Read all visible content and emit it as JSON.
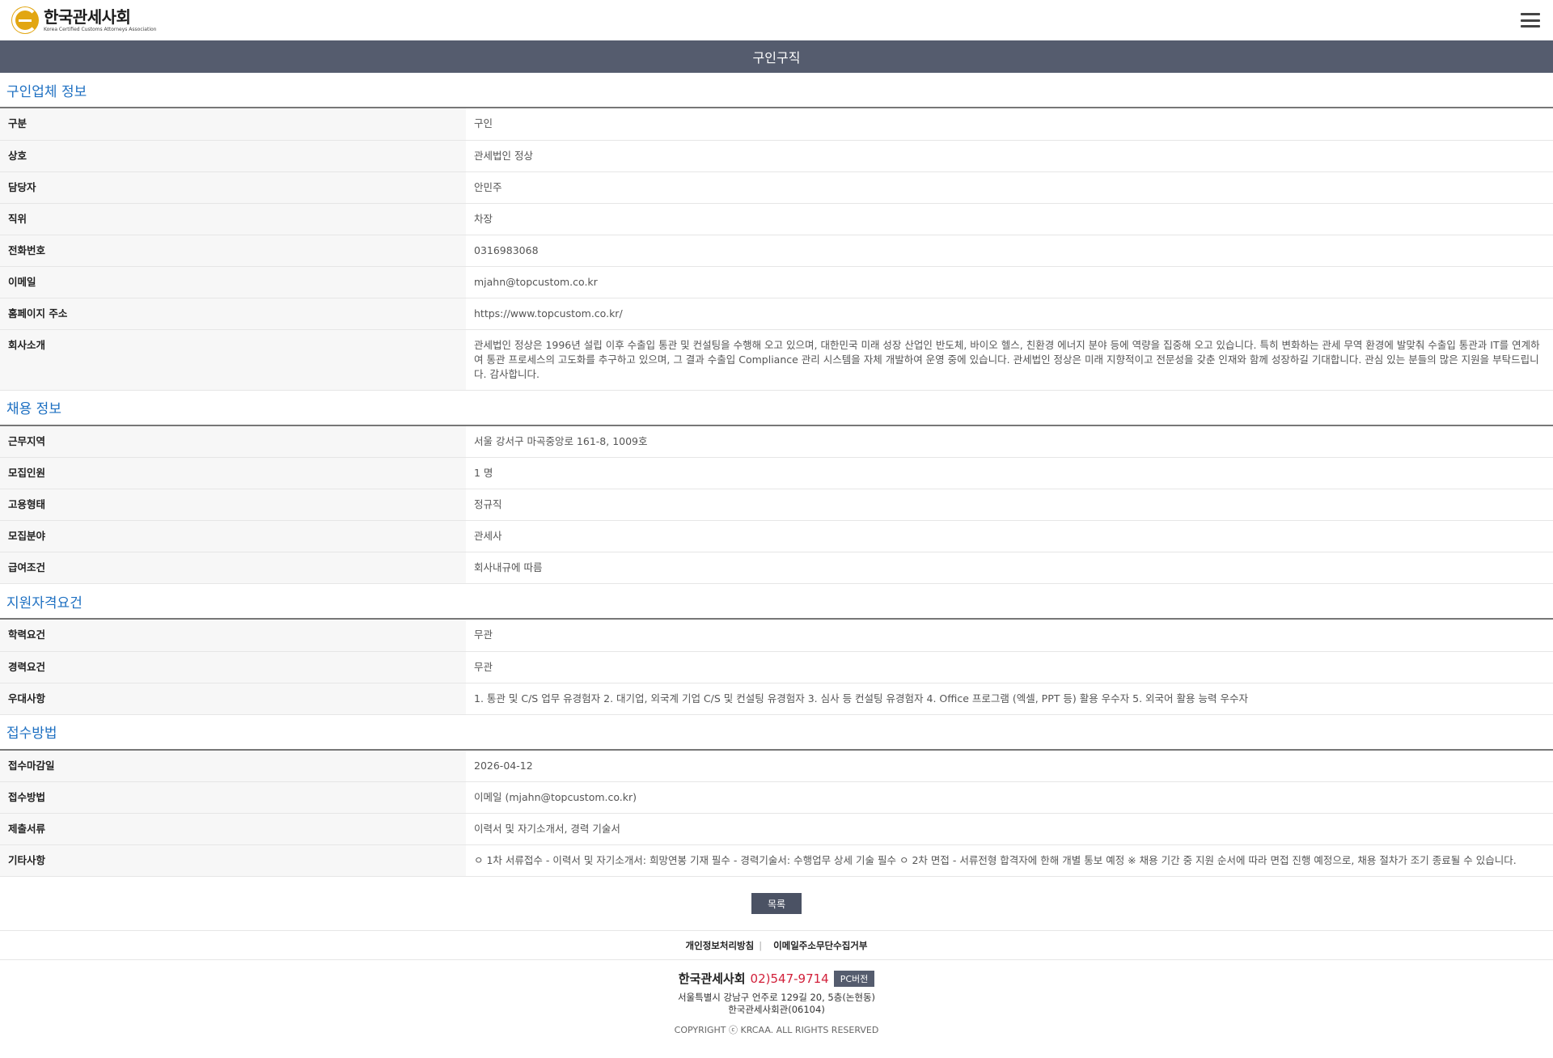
{
  "header": {
    "logo_title": "한국관세사회",
    "logo_sub": "Korea Certified Customs Attorneys Association",
    "menu_icon": "hamburger-menu-icon"
  },
  "page_title": "구인구직",
  "sections": [
    {
      "title": "구인업체 정보",
      "rows": [
        {
          "label": "구분",
          "value": "구인"
        },
        {
          "label": "상호",
          "value": "관세법인 정상"
        },
        {
          "label": "담당자",
          "value": "안민주"
        },
        {
          "label": "직위",
          "value": "차장"
        },
        {
          "label": "전화번호",
          "value": "0316983068"
        },
        {
          "label": "이메일",
          "value": "mjahn@topcustom.co.kr"
        },
        {
          "label": "홈페이지 주소",
          "value": "https://www.topcustom.co.kr/"
        },
        {
          "label": "회사소개",
          "value": "관세법인 정상은 1996년 설립 이후 수출입 통관 및 컨설팅을 수행해 오고 있으며, 대한민국 미래 성장 산업인 반도체, 바이오 헬스, 친환경 에너지 분야 등에 역량을 집중해 오고 있습니다. 특히 변화하는 관세 무역 환경에 발맞춰 수출입 통관과 IT를 연계하여 통관 프로세스의 고도화를 추구하고 있으며, 그 결과 수출입 Compliance 관리 시스템을 자체 개발하여 운영 중에 있습니다. 관세법인 정상은 미래 지향적이고 전문성을 갖춘 인재와 함께 성장하길 기대합니다. 관심 있는 분들의 많은 지원을 부탁드립니다. 감사합니다."
        }
      ]
    },
    {
      "title": "채용 정보",
      "rows": [
        {
          "label": "근무지역",
          "value": "서울 강서구 마곡중앙로 161-8, 1009호"
        },
        {
          "label": "모집인원",
          "value": "1 명"
        },
        {
          "label": "고용형태",
          "value": "정규직"
        },
        {
          "label": "모집분야",
          "value": "관세사"
        },
        {
          "label": "급여조건",
          "value": "회사내규에 따름"
        }
      ]
    },
    {
      "title": "지원자격요건",
      "rows": [
        {
          "label": "학력요건",
          "value": "무관"
        },
        {
          "label": "경력요건",
          "value": "무관"
        },
        {
          "label": "우대사항",
          "value": "1. 통관 및 C/S 업무 유경험자 2. 대기업, 외국계 기업 C/S 및 컨설팅 유경험자 3. 심사 등 컨설팅 유경험자 4. Office 프로그램 (엑셀, PPT 등) 활용 우수자 5. 외국어 활용 능력 우수자"
        }
      ]
    },
    {
      "title": "접수방법",
      "rows": [
        {
          "label": "접수마감일",
          "value": "2026-04-12"
        },
        {
          "label": "접수방법",
          "value": "이메일 (mjahn@topcustom.co.kr)"
        },
        {
          "label": "제출서류",
          "value": "이력서 및 자기소개서, 경력 기술서"
        },
        {
          "label": "기타사항",
          "value": "ㅇ 1차 서류접수 - 이력서 및 자기소개서: 희망연봉 기재 필수 - 경력기술서: 수행업무 상세 기술 필수 ㅇ 2차 면접 - 서류전형 합격자에 한해 개별 통보 예정 ※ 채용 기간 중 지원 순서에 따라 면접 진행 예정으로, 채용 절차가 조기 종료될 수 있습니다."
        }
      ]
    }
  ],
  "list_button": "목록",
  "footer_links": {
    "privacy": "개인정보처리방침",
    "separator": "|",
    "email_refuse": "이메일주소무단수집거부"
  },
  "footer": {
    "org_name": "한국관세사회",
    "phone": "02)547-9714",
    "pc_button": "PC버전",
    "address_line1": "서울특별시 강남구 언주로 129길 20, 5층(논현동)",
    "address_line2": "한국관세사회관(06104)",
    "copyright": "COPYRIGHT ⓒ KRCAA. ALL RIGHTS RESERVED"
  }
}
